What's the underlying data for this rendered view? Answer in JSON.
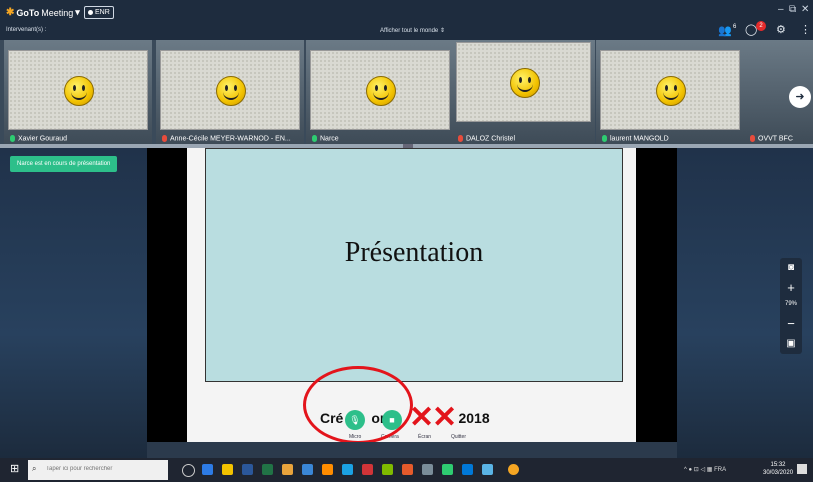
{
  "app": {
    "logo_primary": "GoTo",
    "logo_secondary": "Meeting",
    "rec_label": "ENR",
    "speakers_label": "Intervenant(s) :",
    "showall_label": "Afficher tout le monde"
  },
  "topbar": {
    "people_count": "6",
    "notif_count": "2"
  },
  "participants": [
    {
      "name": "Xavier Gouraud",
      "mic": "on"
    },
    {
      "name": "Anne-Cécile MEYER-WARNOD - EN...",
      "mic": "off"
    },
    {
      "name": "Narce",
      "mic": "on"
    },
    {
      "name": "DALOZ Christel",
      "mic": "off"
    },
    {
      "name": "laurent MANGOLD",
      "mic": "on"
    },
    {
      "name": "OVVT BFC",
      "mic": "off"
    }
  ],
  "stage": {
    "status": "Narce est en cours de présentation",
    "slide_title": "Présentation",
    "subtitle_left": "Cré",
    "subtitle_mid": "on",
    "subtitle_right": "2018",
    "controls": [
      {
        "label": "Micro"
      },
      {
        "label": "Caméra"
      },
      {
        "label": "Écran"
      },
      {
        "label": "Quitter"
      }
    ],
    "zoom": "79%"
  },
  "taskbar": {
    "search_placeholder": "Taper ici pour rechercher",
    "lang": "FRA",
    "time": "15:32",
    "date": "30/03/2020"
  }
}
